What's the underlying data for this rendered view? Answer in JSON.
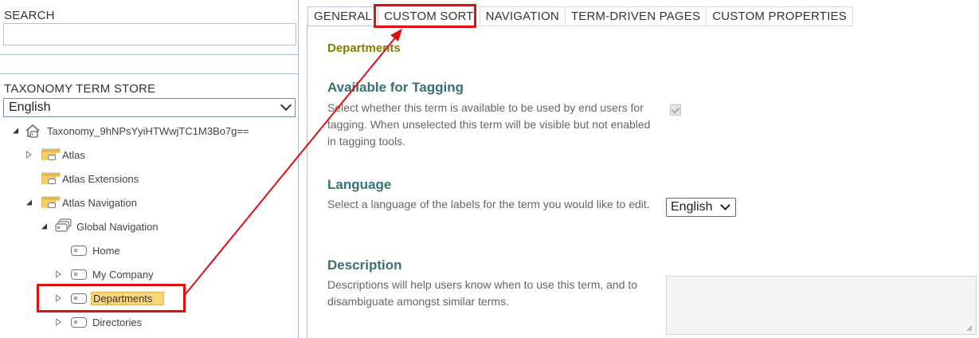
{
  "left": {
    "search_label": "SEARCH",
    "search_value": "",
    "store_label": "TAXONOMY TERM STORE",
    "language": "English",
    "tree": {
      "root": "Taxonomy_9hNPsYyiHTWwjTC1M3Bo7g==",
      "atlas": "Atlas",
      "atlas_extensions": "Atlas Extensions",
      "atlas_navigation": "Atlas Navigation",
      "global_navigation": "Global Navigation",
      "home": "Home",
      "my_company": "My Company",
      "departments": "Departments",
      "directories": "Directories"
    }
  },
  "tabs": [
    "GENERAL",
    "CUSTOM SORT",
    "NAVIGATION",
    "TERM-DRIVEN PAGES",
    "CUSTOM PROPERTIES"
  ],
  "general": {
    "term_name": "Departments",
    "available": {
      "title": "Available for Tagging",
      "desc": "Select whether this term is available to be used by end users for tagging. When unselected this term will be visible but not enabled in tagging tools.",
      "checked": true
    },
    "language": {
      "title": "Language",
      "desc": "Select a language of the labels for the term you would like to edit.",
      "value": "English"
    },
    "description": {
      "title": "Description",
      "desc": "Descriptions will help users know when to use this term, and to disambiguate amongst similar terms.",
      "value": ""
    }
  },
  "colors": {
    "annotation": "#e01010",
    "selected_highlight": "#fbd57a",
    "section_title": "#3b7070",
    "term_name": "#7e7e00"
  }
}
